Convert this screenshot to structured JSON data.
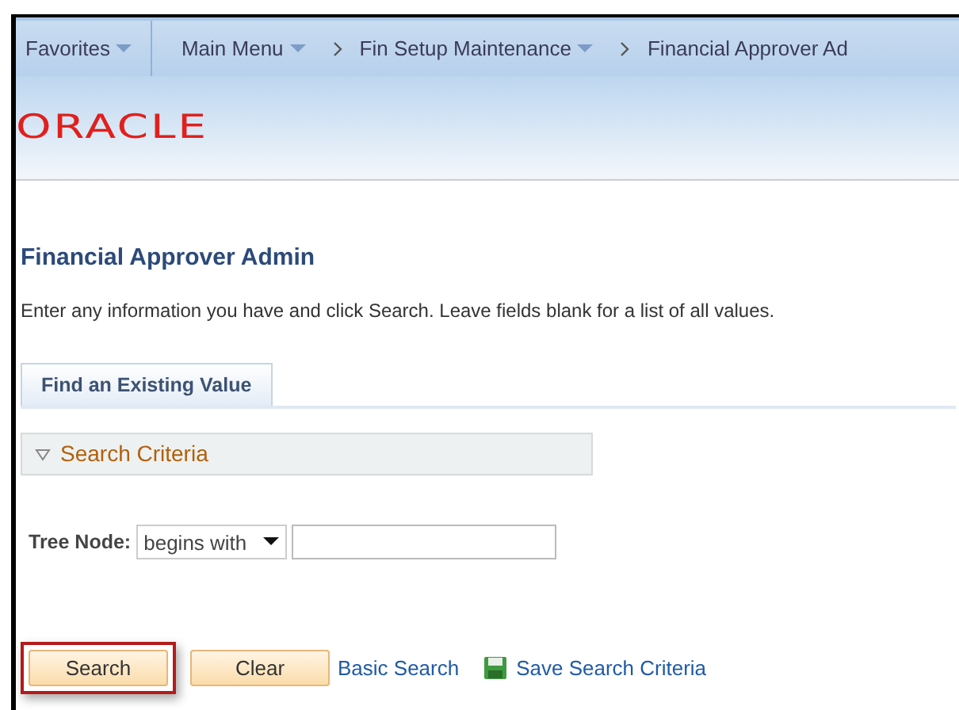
{
  "breadcrumb": [
    {
      "label": "Favorites",
      "dropdown": true,
      "kind": "plain"
    },
    {
      "label": "Main Menu",
      "dropdown": true,
      "kind": "divided"
    },
    {
      "label": "Fin Setup Maintenance",
      "dropdown": true,
      "kind": "chevron"
    },
    {
      "label": "Financial Approver Ad",
      "dropdown": false,
      "kind": "chevron"
    }
  ],
  "logo": "ORACLE",
  "page_title": "Financial Approver Admin",
  "instructions": "Enter any information you have and click Search. Leave fields blank for a list of all values.",
  "tabs": [
    {
      "label": "Find an Existing Value",
      "selected": true
    }
  ],
  "section": {
    "label": "Search Criteria",
    "expanded": true
  },
  "fields": [
    {
      "label": "Tree Node:",
      "operator": "begins with"
    }
  ],
  "buttons": [
    {
      "label": "Search",
      "highlighted": true
    },
    {
      "label": "Clear",
      "highlighted": false
    }
  ],
  "links": [
    {
      "label": "Basic Search",
      "icon": false
    },
    {
      "label": "Save Search Criteria",
      "icon": true
    }
  ]
}
